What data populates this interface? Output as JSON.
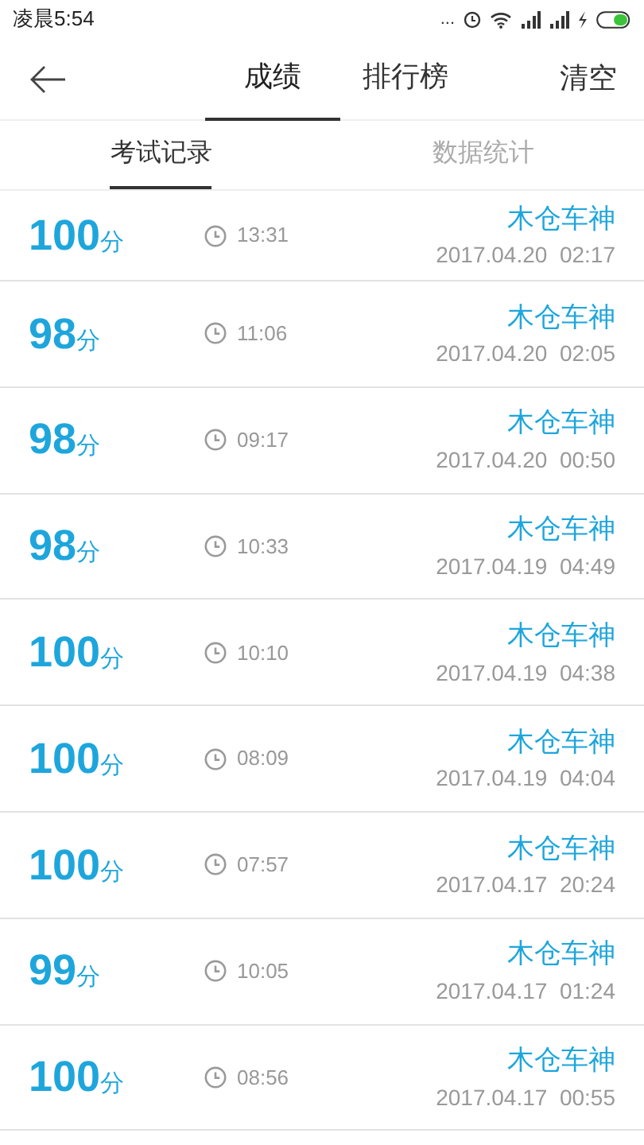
{
  "status_bar": {
    "time": "凌晨5:54",
    "dots": "..."
  },
  "header": {
    "tabs": [
      {
        "label": "成绩",
        "selected": true
      },
      {
        "label": "排行榜",
        "selected": false
      }
    ],
    "action": "清空"
  },
  "subtabs": [
    {
      "label": "考试记录",
      "selected": true
    },
    {
      "label": "数据统计",
      "selected": false
    }
  ],
  "records": [
    {
      "score": "100",
      "unit": "分",
      "duration": "13:31",
      "name": "木仓车神",
      "date": "2017.04.20  02:17"
    },
    {
      "score": "98",
      "unit": "分",
      "duration": "11:06",
      "name": "木仓车神",
      "date": "2017.04.20  02:05"
    },
    {
      "score": "98",
      "unit": "分",
      "duration": "09:17",
      "name": "木仓车神",
      "date": "2017.04.20  00:50"
    },
    {
      "score": "98",
      "unit": "分",
      "duration": "10:33",
      "name": "木仓车神",
      "date": "2017.04.19  04:49"
    },
    {
      "score": "100",
      "unit": "分",
      "duration": "10:10",
      "name": "木仓车神",
      "date": "2017.04.19  04:38"
    },
    {
      "score": "100",
      "unit": "分",
      "duration": "08:09",
      "name": "木仓车神",
      "date": "2017.04.19  04:04"
    },
    {
      "score": "100",
      "unit": "分",
      "duration": "07:57",
      "name": "木仓车神",
      "date": "2017.04.17  20:24"
    },
    {
      "score": "99",
      "unit": "分",
      "duration": "10:05",
      "name": "木仓车神",
      "date": "2017.04.17  01:24"
    },
    {
      "score": "100",
      "unit": "分",
      "duration": "08:56",
      "name": "木仓车神",
      "date": "2017.04.17  00:55"
    }
  ]
}
